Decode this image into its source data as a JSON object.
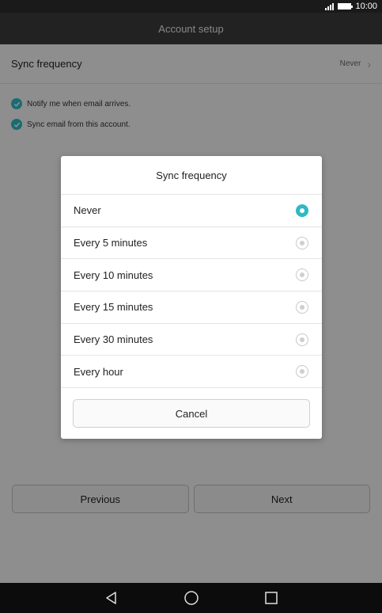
{
  "status_bar": {
    "time": "10:00"
  },
  "app_bar": {
    "title": "Account setup"
  },
  "settings": {
    "sync_frequency_label": "Sync frequency",
    "sync_frequency_value": "Never",
    "checkboxes": [
      {
        "label": "Notify me when email arrives.",
        "checked": true
      },
      {
        "label": "Sync email from this account.",
        "checked": true
      }
    ]
  },
  "buttons": {
    "previous": "Previous",
    "next": "Next"
  },
  "dialog": {
    "title": "Sync frequency",
    "options": [
      {
        "label": "Never",
        "selected": true
      },
      {
        "label": "Every 5 minutes",
        "selected": false
      },
      {
        "label": "Every 10 minutes",
        "selected": false
      },
      {
        "label": "Every 15 minutes",
        "selected": false
      },
      {
        "label": "Every 30 minutes",
        "selected": false
      },
      {
        "label": "Every hour",
        "selected": false
      }
    ],
    "cancel": "Cancel"
  },
  "colors": {
    "accent": "#2fb9c4",
    "app_bar": "#3c3c3c",
    "nav_bar": "#0c0c0c"
  },
  "icons": {
    "status": [
      "signal-icon",
      "battery-icon"
    ],
    "nav": [
      "back-icon",
      "home-icon",
      "recents-icon"
    ],
    "checkbox": "check-icon",
    "chevron": "chevron-right-icon"
  }
}
